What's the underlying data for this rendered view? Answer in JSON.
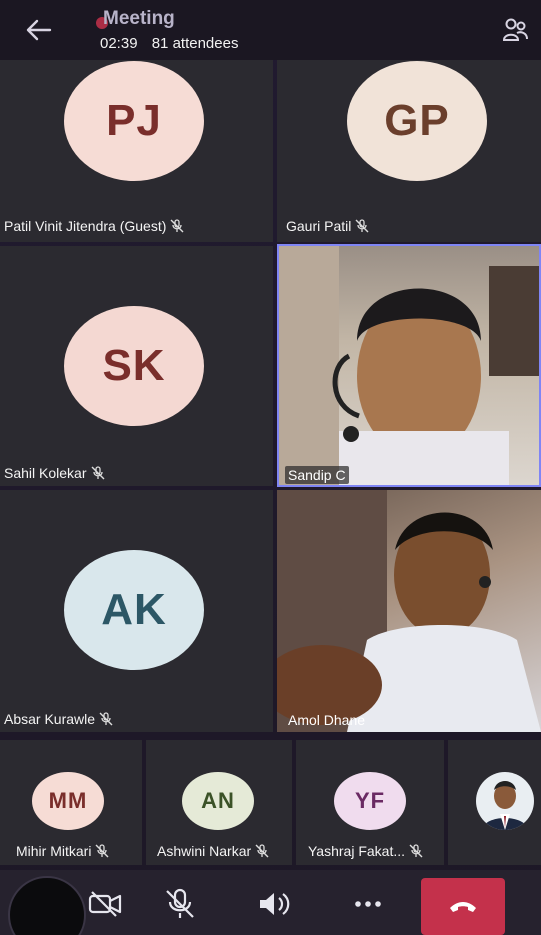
{
  "header": {
    "title": "Meeting",
    "duration": "02:39",
    "attendees": "81 attendees"
  },
  "tiles": [
    {
      "initials": "PJ",
      "name": "Patil Vinit Jitendra (Guest)",
      "avatar_bg": "#f6dcd5",
      "avatar_fg": "#7a2e2b"
    },
    {
      "initials": "GP",
      "name": "Gauri Patil",
      "avatar_bg": "#f1e3d8",
      "avatar_fg": "#6b3f2c"
    },
    {
      "initials": "SK",
      "name": "Sahil Kolekar",
      "avatar_bg": "#f4d8d2",
      "avatar_fg": "#7a2e2b"
    },
    {
      "name": "Sandip C"
    },
    {
      "initials": "AK",
      "name": "Absar Kurawle",
      "avatar_bg": "#d9e7ec",
      "avatar_fg": "#2c5766"
    },
    {
      "name": "Amol Dhane"
    }
  ],
  "strip": [
    {
      "initials": "MM",
      "name": "Mihir Mitkari",
      "avatar_bg": "#f6dcd5",
      "avatar_fg": "#7a2e2b"
    },
    {
      "initials": "AN",
      "name": "Ashwini Narkar",
      "avatar_bg": "#e5ead7",
      "avatar_fg": "#3b5227"
    },
    {
      "initials": "YF",
      "name": "Yashraj Fakat...",
      "avatar_bg": "#f0dcee",
      "avatar_fg": "#6a2a63"
    }
  ],
  "controls": {
    "icons": [
      "camera-off-icon",
      "mic-off-icon",
      "speaker-icon",
      "more-icon",
      "hang-up-icon"
    ],
    "hangup_color": "#c4314b"
  }
}
